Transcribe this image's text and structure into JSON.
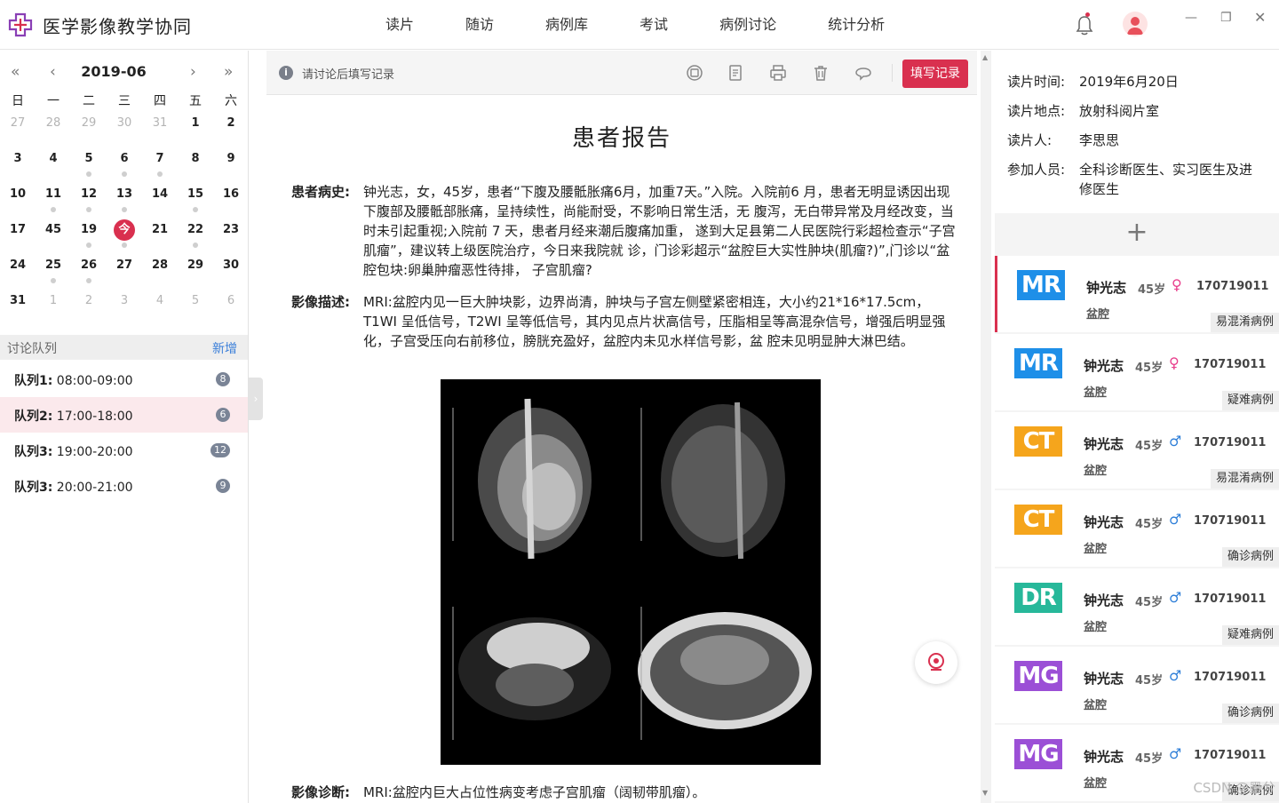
{
  "app": {
    "title": "医学影像教学协同"
  },
  "nav": [
    "读片",
    "随访",
    "病例库",
    "考试",
    "病例讨论",
    "统计分析"
  ],
  "calendar": {
    "month": "2019-06",
    "weekdays": [
      "日",
      "一",
      "二",
      "三",
      "四",
      "五",
      "六"
    ],
    "today_label": "今",
    "rows": [
      [
        "27",
        "28",
        "29",
        "30",
        "31",
        "1",
        "2"
      ],
      [
        "3",
        "4",
        "5",
        "6",
        "7",
        "8",
        "9"
      ],
      [
        "10",
        "11",
        "12",
        "13",
        "14",
        "15",
        "16"
      ],
      [
        "17",
        "45",
        "19",
        "今",
        "21",
        "22",
        "23"
      ],
      [
        "24",
        "25",
        "26",
        "27",
        "28",
        "29",
        "30"
      ],
      [
        "31",
        "1",
        "2",
        "3",
        "4",
        "5",
        "6"
      ]
    ]
  },
  "queue": {
    "label": "讨论队列",
    "add_label": "新增",
    "items": [
      {
        "name": "队列1:",
        "time": "08:00-09:00",
        "count": "8"
      },
      {
        "name": "队列2:",
        "time": "17:00-18:00",
        "count": "6"
      },
      {
        "name": "队列3:",
        "time": "19:00-20:00",
        "count": "12"
      },
      {
        "name": "队列3:",
        "time": "20:00-21:00",
        "count": "9"
      }
    ]
  },
  "toolbar": {
    "hint": "请讨论后填写记录",
    "fill_button": "填写记录"
  },
  "report": {
    "title": "患者报告",
    "history_label": "患者病史:",
    "history": "钟光志，女，45岁，患者“下腹及腰骶胀痛6月，加重7天。”入院。入院前6 月，患者无明显诱因出现下腹部及腰骶部胀痛，呈持续性，尚能耐受，不影响日常生活，无 腹泻，无白带异常及月经改变，当时未引起重视;入院前 7 天，患者月经来潮后腹痛加重， 遂到大足县第二人民医院行彩超检查示“子宫肌瘤”，建议转上级医院治疗，今日来我院就 诊，门诊彩超示“盆腔巨大实性肿块(肌瘤?)”,门诊以“盆腔包块:卵巢肿瘤恶性待排， 子宫肌瘤?",
    "imaging_label": "影像描述:",
    "imaging": "MRI:盆腔内见一巨大肿块影，边界尚清，肿块与子宫左侧壁紧密相连，大小约21*16*17.5cm，T1WI 呈低信号，T2WI 呈等低信号，其内见点片状高信号，压脂相呈等高混杂信号，增强后明显强化，子宫受压向右前移位，膀胱充盈好，盆腔内未见水样信号影，盆 腔未见明显肿大淋巴结。",
    "diagnosis_label": "影像诊断:",
    "diagnosis": "MRI:盆腔内巨大占位性病变考虑子宫肌瘤（阔韧带肌瘤）。"
  },
  "read_info": {
    "time_label": "读片时间:",
    "time": "2019年6月20日",
    "place_label": "读片地点:",
    "place": "放射科阅片室",
    "reader_label": "读片人:",
    "reader": "李思思",
    "participants_label": "参加人员:",
    "participants": "全科诊断医生、实习医生及进修医生"
  },
  "cases": [
    {
      "modality": "MR",
      "color": "#1e8fe8",
      "name": "钟光志",
      "age": "45岁",
      "sex": "♀",
      "sex_color": "#e83e8c",
      "id": "170719011",
      "part": "盆腔",
      "tag": "易混淆病例"
    },
    {
      "modality": "MR",
      "color": "#1e8fe8",
      "name": "钟光志",
      "age": "45岁",
      "sex": "♀",
      "sex_color": "#e83e8c",
      "id": "170719011",
      "part": "盆腔",
      "tag": "疑难病例"
    },
    {
      "modality": "CT",
      "color": "#f5a51c",
      "name": "钟光志",
      "age": "45岁",
      "sex": "♂",
      "sex_color": "#2f7fd8",
      "id": "170719011",
      "part": "盆腔",
      "tag": "易混淆病例"
    },
    {
      "modality": "CT",
      "color": "#f5a51c",
      "name": "钟光志",
      "age": "45岁",
      "sex": "♂",
      "sex_color": "#2f7fd8",
      "id": "170719011",
      "part": "盆腔",
      "tag": "确诊病例"
    },
    {
      "modality": "DR",
      "color": "#27b89a",
      "name": "钟光志",
      "age": "45岁",
      "sex": "♂",
      "sex_color": "#2f7fd8",
      "id": "170719011",
      "part": "盆腔",
      "tag": "疑难病例"
    },
    {
      "modality": "MG",
      "color": "#9b4fd6",
      "name": "钟光志",
      "age": "45岁",
      "sex": "♂",
      "sex_color": "#2f7fd8",
      "id": "170719011",
      "part": "盆腔",
      "tag": "确诊病例"
    },
    {
      "modality": "MG",
      "color": "#9b4fd6",
      "name": "钟光志",
      "age": "45岁",
      "sex": "♂",
      "sex_color": "#2f7fd8",
      "id": "170719011",
      "part": "盆腔",
      "tag": "确诊病例"
    }
  ],
  "watermark": "CSDN @墨兮"
}
